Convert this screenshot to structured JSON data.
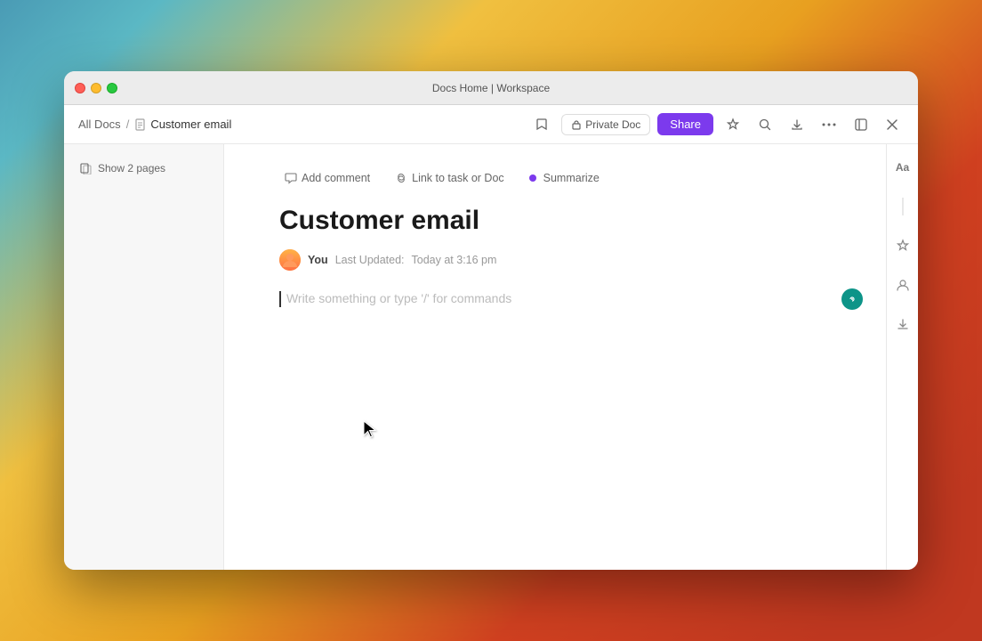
{
  "window": {
    "title": "Docs Home | Workspace"
  },
  "traffic_lights": {
    "close": "close",
    "minimize": "minimize",
    "maximize": "maximize"
  },
  "breadcrumb": {
    "root_label": "All Docs",
    "separator": "/",
    "current_label": "Customer email"
  },
  "toolbar": {
    "private_doc_label": "Private Doc",
    "share_label": "Share",
    "lock_icon": "🔒",
    "star_icon": "☆",
    "search_icon": "🔍",
    "export_icon": "⬇",
    "more_icon": "···",
    "collapse_icon": "⊡",
    "close_icon": "✕"
  },
  "sidebar": {
    "show_pages_label": "Show 2 pages",
    "pages_icon": "⊡"
  },
  "doc_toolbar": {
    "add_comment_label": "Add comment",
    "link_task_label": "Link to task or Doc",
    "summarize_label": "Summarize",
    "comment_icon": "○",
    "link_icon": "🔗"
  },
  "document": {
    "title": "Customer email",
    "author_name": "You",
    "last_updated_label": "Last Updated:",
    "last_updated_time": "Today at 3:16 pm",
    "placeholder": "Write something or type '/' for commands"
  },
  "right_sidebar": {
    "text_format_icon": "Aa",
    "star_icon": "✦",
    "user_icon": "👤",
    "download_icon": "⬇"
  },
  "colors": {
    "accent": "#7c3aed",
    "teal": "#0d9488"
  }
}
